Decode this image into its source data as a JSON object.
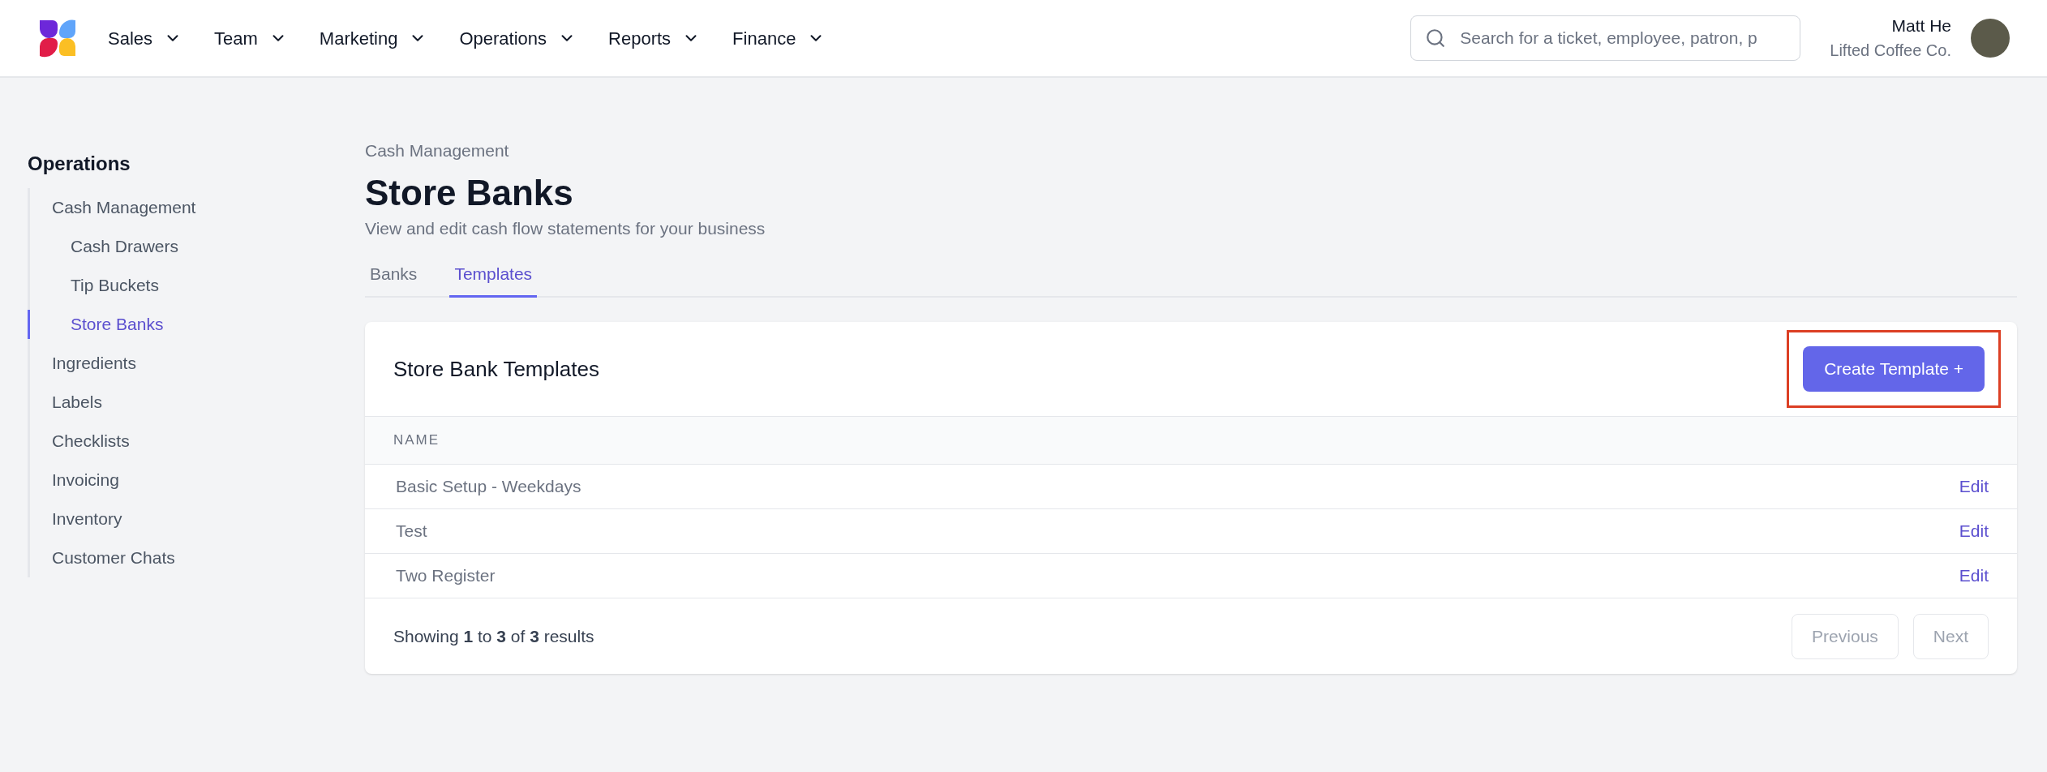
{
  "top_nav": {
    "menus": [
      {
        "label": "Sales"
      },
      {
        "label": "Team"
      },
      {
        "label": "Marketing"
      },
      {
        "label": "Operations"
      },
      {
        "label": "Reports"
      },
      {
        "label": "Finance"
      }
    ],
    "search": {
      "placeholder": "Search for a ticket, employee, patron, p"
    },
    "user": {
      "name": "Matt He",
      "company": "Lifted Coffee Co."
    }
  },
  "sidebar": {
    "title": "Operations",
    "items": [
      {
        "label": "Cash Management",
        "selected": false,
        "children": [
          {
            "label": "Cash Drawers",
            "selected": false
          },
          {
            "label": "Tip Buckets",
            "selected": false
          },
          {
            "label": "Store Banks",
            "selected": true
          }
        ]
      },
      {
        "label": "Ingredients",
        "selected": false
      },
      {
        "label": "Labels",
        "selected": false
      },
      {
        "label": "Checklists",
        "selected": false
      },
      {
        "label": "Invoicing",
        "selected": false
      },
      {
        "label": "Inventory",
        "selected": false
      },
      {
        "label": "Customer Chats",
        "selected": false
      }
    ]
  },
  "header": {
    "breadcrumb": "Cash Management",
    "title": "Store Banks",
    "subtitle": "View and edit cash flow statements for your business"
  },
  "tabs": [
    {
      "label": "Banks",
      "selected": false
    },
    {
      "label": "Templates",
      "selected": true
    }
  ],
  "card": {
    "title": "Store Bank Templates",
    "action": {
      "label": "Create Template +",
      "highlighted": true
    },
    "table": {
      "columns": [
        "NAME"
      ],
      "rows": [
        {
          "name": "Basic Setup - Weekdays",
          "action": "Edit"
        },
        {
          "name": "Test",
          "action": "Edit"
        },
        {
          "name": "Two Register",
          "action": "Edit"
        }
      ]
    },
    "footer": {
      "summary": "Showing **1** to **3** of **3** results",
      "buttons": [
        {
          "label": "Previous",
          "disabled": true
        },
        {
          "label": "Next",
          "disabled": true
        }
      ]
    }
  }
}
